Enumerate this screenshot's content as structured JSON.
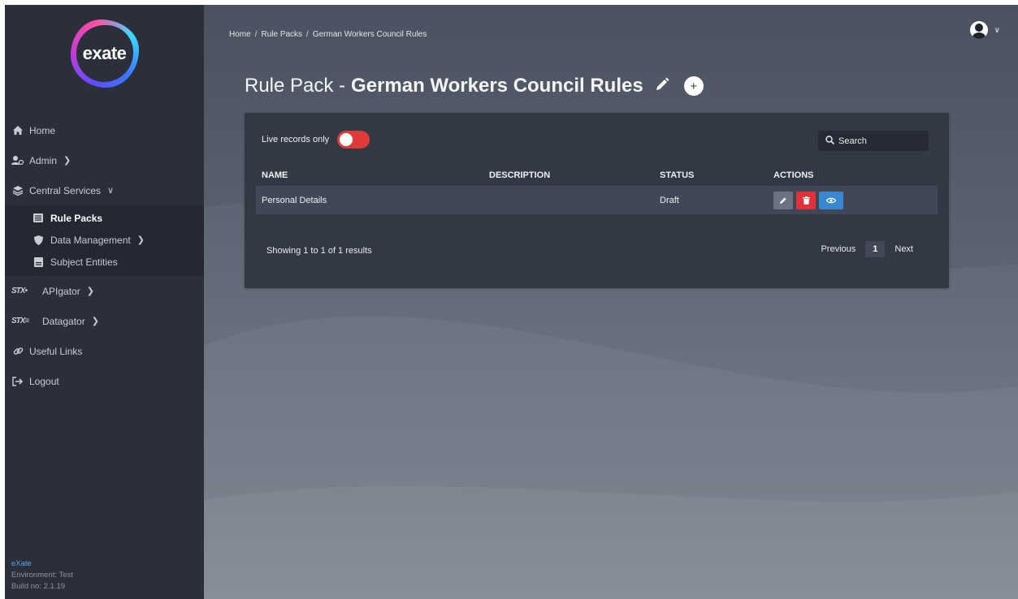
{
  "sidebar": {
    "logo_text": "exate",
    "nav": {
      "home": "Home",
      "admin": "Admin",
      "central_services": "Central Services",
      "rule_packs": "Rule Packs",
      "data_management": "Data Management",
      "subject_entities": "Subject Entities",
      "apigator": "APIgator",
      "datagator": "Datagator",
      "useful_links": "Useful Links",
      "logout": "Logout"
    },
    "footer": {
      "brand": "eXate",
      "environment": "Environment: Test",
      "build": "Build no: 2.1.19"
    }
  },
  "breadcrumb": {
    "home": "Home",
    "rule_packs": "Rule Packs",
    "current": "German Workers Council Rules",
    "separator": "/"
  },
  "header": {
    "title_prefix": "Rule Pack -",
    "title_name": "German Workers Council Rules",
    "add_label": "+"
  },
  "panel": {
    "live_records_label": "Live records only",
    "search_placeholder": "Search",
    "columns": {
      "name": "NAME",
      "description": "DESCRIPTION",
      "status": "STATUS",
      "actions": "ACTIONS"
    },
    "rows": [
      {
        "name": "Personal Details",
        "description": "",
        "status": "Draft"
      }
    ],
    "results_text": "Showing 1 to 1 of 1 results",
    "pagination": {
      "previous": "Previous",
      "page": "1",
      "next": "Next"
    }
  },
  "colors": {
    "sidebar_bg": "#2b2f3a",
    "panel_bg": "#333845",
    "toggle_red": "#e03b3b",
    "delete_red": "#e0323b",
    "view_blue": "#3a87d1",
    "footer_brand": "#5aa7e8"
  },
  "icons": {
    "home": "home-icon",
    "admin": "users-icon",
    "central_services": "layers-icon",
    "rule_packs": "list-icon",
    "data_management": "shield-icon",
    "subject_entities": "document-icon",
    "useful_links": "link-icon",
    "logout": "logout-icon"
  }
}
